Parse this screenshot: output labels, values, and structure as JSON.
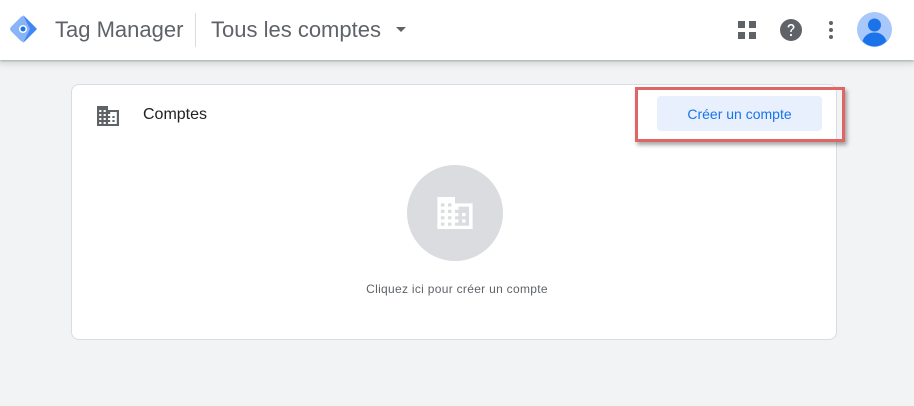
{
  "header": {
    "product_name": "Tag Manager",
    "account_switcher": "Tous les comptes",
    "icons": [
      "apps-grid-icon",
      "help-icon",
      "more-vert-icon",
      "avatar-icon"
    ]
  },
  "card": {
    "title": "Comptes",
    "title_icon": "building-icon",
    "create_button": "Créer un compte",
    "empty_state_icon": "building-icon",
    "empty_state_text": "Cliquez ici pour créer un compte"
  },
  "colors": {
    "accent": "#1a73e8",
    "button_bg": "#e8f0fe",
    "highlight_border": "#e06666",
    "page_bg": "#f1f3f4"
  }
}
